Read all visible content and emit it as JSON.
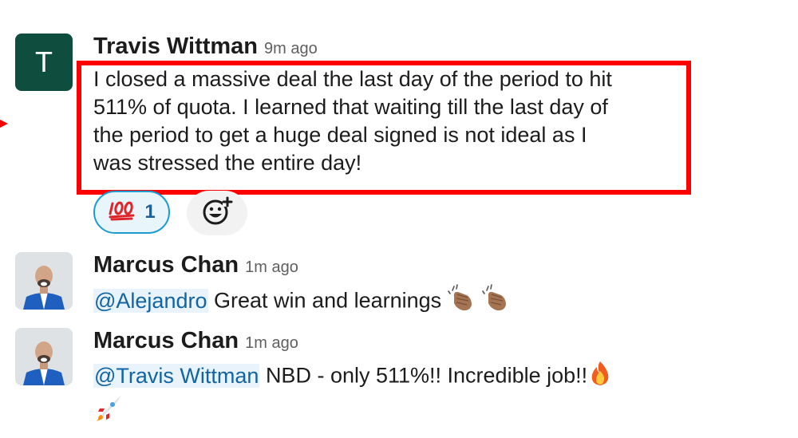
{
  "messages": [
    {
      "author": "Travis Wittman",
      "avatar_initial": "T",
      "time": "9m ago",
      "lines": [
        "I closed a massive deal the last day of the period to hit",
        "511% of quota. I learned that waiting till the last day of",
        "the period to get a huge deal signed is not ideal as I",
        "was stressed the entire day!"
      ],
      "reaction": {
        "emoji": "hundred-points-icon",
        "count": "1"
      }
    },
    {
      "author": "Marcus Chan",
      "time": "1m ago",
      "mention": "@Alejandro",
      "text": "Great win and learnings",
      "emojis": [
        "clapping-hands-icon",
        "clapping-hands-icon"
      ]
    },
    {
      "author": "Marcus Chan",
      "time": "1m ago",
      "mention": "@Travis Wittman",
      "text": "NBD - only 511%!! Incredible job!!",
      "emojis": [
        "fire-icon",
        "rocket-icon"
      ]
    }
  ],
  "colors": {
    "highlight": "#ff0000",
    "mention": "#1264a3",
    "avatar_bg": "#0f4d3f"
  }
}
